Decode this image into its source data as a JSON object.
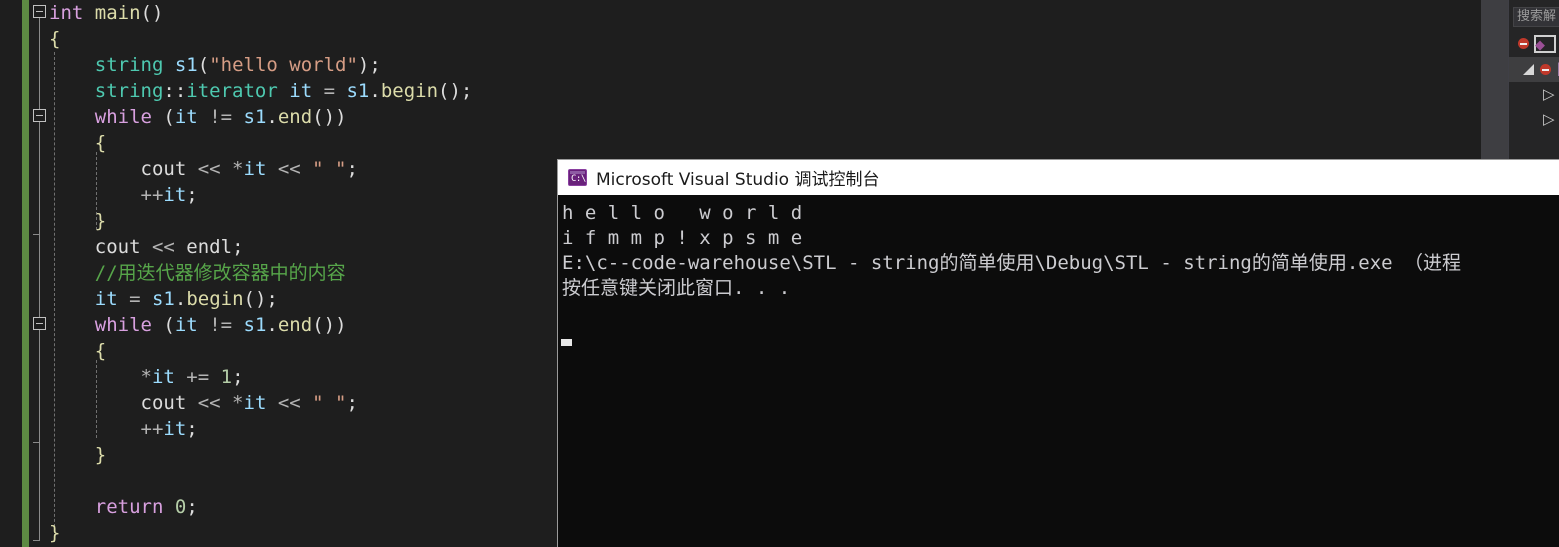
{
  "app": {
    "ide_name": "Microsoft Visual Studio",
    "theme": "dark"
  },
  "colors": {
    "editor_background": "#1e1e1e",
    "keyword": "#d8a0df",
    "type": "#4ec9b0",
    "identifier": "#9cdcfe",
    "method": "#dcdcaa",
    "string": "#d69d85",
    "comment": "#57a64a",
    "plain_text": "#dcdcdc",
    "number": "#b5cea8",
    "change_bar_saved": "#5d8a43",
    "console_background": "#0c0c0c",
    "console_text": "#ccccd0",
    "console_titlebar": "#ffffff"
  },
  "editor": {
    "lines": [
      {
        "indent": 0,
        "tokens": [
          {
            "t": "int",
            "c": "kw"
          },
          {
            "t": " ",
            "c": "plain"
          },
          {
            "t": "main",
            "c": "fn"
          },
          {
            "t": "()",
            "c": "punc"
          }
        ]
      },
      {
        "indent": 0,
        "tokens": [
          {
            "t": "{",
            "c": "brace"
          }
        ]
      },
      {
        "indent": 1,
        "tokens": [
          {
            "t": "string",
            "c": "typ"
          },
          {
            "t": " ",
            "c": "plain"
          },
          {
            "t": "s1",
            "c": "var"
          },
          {
            "t": "(",
            "c": "punc"
          },
          {
            "t": "\"hello world\"",
            "c": "str"
          },
          {
            "t": ");",
            "c": "punc"
          }
        ]
      },
      {
        "indent": 1,
        "tokens": [
          {
            "t": "string",
            "c": "typ"
          },
          {
            "t": "::",
            "c": "punc"
          },
          {
            "t": "iterator",
            "c": "typ"
          },
          {
            "t": " ",
            "c": "plain"
          },
          {
            "t": "it",
            "c": "var"
          },
          {
            "t": " = ",
            "c": "op"
          },
          {
            "t": "s1",
            "c": "var"
          },
          {
            "t": ".",
            "c": "punc"
          },
          {
            "t": "begin",
            "c": "fn"
          },
          {
            "t": "();",
            "c": "punc"
          }
        ]
      },
      {
        "indent": 1,
        "tokens": [
          {
            "t": "while",
            "c": "kw"
          },
          {
            "t": " (",
            "c": "punc"
          },
          {
            "t": "it",
            "c": "var"
          },
          {
            "t": " != ",
            "c": "op"
          },
          {
            "t": "s1",
            "c": "var"
          },
          {
            "t": ".",
            "c": "punc"
          },
          {
            "t": "end",
            "c": "fn"
          },
          {
            "t": "())",
            "c": "punc"
          }
        ]
      },
      {
        "indent": 1,
        "tokens": [
          {
            "t": "{",
            "c": "brace"
          }
        ]
      },
      {
        "indent": 2,
        "tokens": [
          {
            "t": "cout",
            "c": "plain"
          },
          {
            "t": " << ",
            "c": "op"
          },
          {
            "t": "*",
            "c": "op"
          },
          {
            "t": "it",
            "c": "var"
          },
          {
            "t": " << ",
            "c": "op"
          },
          {
            "t": "\" \"",
            "c": "str"
          },
          {
            "t": ";",
            "c": "punc"
          }
        ]
      },
      {
        "indent": 2,
        "tokens": [
          {
            "t": "++",
            "c": "op"
          },
          {
            "t": "it",
            "c": "var"
          },
          {
            "t": ";",
            "c": "punc"
          }
        ]
      },
      {
        "indent": 1,
        "tokens": [
          {
            "t": "}",
            "c": "brace"
          }
        ]
      },
      {
        "indent": 1,
        "tokens": [
          {
            "t": "cout",
            "c": "plain"
          },
          {
            "t": " << ",
            "c": "op"
          },
          {
            "t": "endl",
            "c": "plain"
          },
          {
            "t": ";",
            "c": "punc"
          }
        ]
      },
      {
        "indent": 1,
        "tokens": [
          {
            "t": "//用迭代器修改容器中的内容",
            "c": "cmt"
          }
        ]
      },
      {
        "indent": 1,
        "tokens": [
          {
            "t": "it",
            "c": "var"
          },
          {
            "t": " = ",
            "c": "op"
          },
          {
            "t": "s1",
            "c": "var"
          },
          {
            "t": ".",
            "c": "punc"
          },
          {
            "t": "begin",
            "c": "fn"
          },
          {
            "t": "();",
            "c": "punc"
          }
        ]
      },
      {
        "indent": 1,
        "tokens": [
          {
            "t": "while",
            "c": "kw"
          },
          {
            "t": " (",
            "c": "punc"
          },
          {
            "t": "it",
            "c": "var"
          },
          {
            "t": " != ",
            "c": "op"
          },
          {
            "t": "s1",
            "c": "var"
          },
          {
            "t": ".",
            "c": "punc"
          },
          {
            "t": "end",
            "c": "fn"
          },
          {
            "t": "())",
            "c": "punc"
          }
        ]
      },
      {
        "indent": 1,
        "tokens": [
          {
            "t": "{",
            "c": "brace"
          }
        ]
      },
      {
        "indent": 2,
        "tokens": [
          {
            "t": "*",
            "c": "op"
          },
          {
            "t": "it",
            "c": "var"
          },
          {
            "t": " += ",
            "c": "op"
          },
          {
            "t": "1",
            "c": "num"
          },
          {
            "t": ";",
            "c": "punc"
          }
        ]
      },
      {
        "indent": 2,
        "tokens": [
          {
            "t": "cout",
            "c": "plain"
          },
          {
            "t": " << ",
            "c": "op"
          },
          {
            "t": "*",
            "c": "op"
          },
          {
            "t": "it",
            "c": "var"
          },
          {
            "t": " << ",
            "c": "op"
          },
          {
            "t": "\" \"",
            "c": "str"
          },
          {
            "t": ";",
            "c": "punc"
          }
        ]
      },
      {
        "indent": 2,
        "tokens": [
          {
            "t": "++",
            "c": "op"
          },
          {
            "t": "it",
            "c": "var"
          },
          {
            "t": ";",
            "c": "punc"
          }
        ]
      },
      {
        "indent": 1,
        "tokens": [
          {
            "t": "}",
            "c": "brace"
          }
        ]
      },
      {
        "indent": 0,
        "tokens": []
      },
      {
        "indent": 1,
        "tokens": [
          {
            "t": "return",
            "c": "kw"
          },
          {
            "t": " ",
            "c": "plain"
          },
          {
            "t": "0",
            "c": "num"
          },
          {
            "t": ";",
            "c": "punc"
          }
        ]
      },
      {
        "indent": 0,
        "tokens": [
          {
            "t": "}",
            "c": "brace"
          }
        ]
      }
    ],
    "plain_source": "int main()\n{\n    string s1(\"hello world\");\n    string::iterator it = s1.begin();\n    while (it != s1.end())\n    {\n        cout << *it << \" \";\n        ++it;\n    }\n    cout << endl;\n    //用迭代器修改容器中的内容\n    it = s1.begin();\n    while (it != s1.end())\n    {\n        *it += 1;\n        cout << *it << \" \";\n        ++it;\n    }\n\n    return 0;\n}"
  },
  "scrollbar": {
    "up_arrow": "scroll-up-arrow-icon",
    "splitter": "editor-splitter-handle"
  },
  "solution_explorer": {
    "search_placeholder": "搜索解",
    "rows": [
      {
        "name": "solution-node",
        "icon": "solution-icon",
        "badge": "stop-badge-icon"
      },
      {
        "name": "project-node",
        "icon": "expander-icon",
        "badge": "stop-badge-icon",
        "selected": true
      },
      {
        "name": "tree-node-3",
        "icon": "chevron-right-icon"
      },
      {
        "name": "tree-node-4",
        "icon": "chevron-right-icon"
      }
    ]
  },
  "console": {
    "title": "Microsoft Visual Studio 调试控制台",
    "icon_label": "C:\\",
    "icon_name": "console-app-icon",
    "output_lines": [
      "h e l l o   w o r l d",
      "i f m m p ! x p s m e",
      "E:\\c--code-warehouse\\STL - string的简单使用\\Debug\\STL - string的简单使用.exe （进程 ",
      "按任意键关闭此窗口. . ."
    ],
    "cursor": "block-cursor"
  }
}
